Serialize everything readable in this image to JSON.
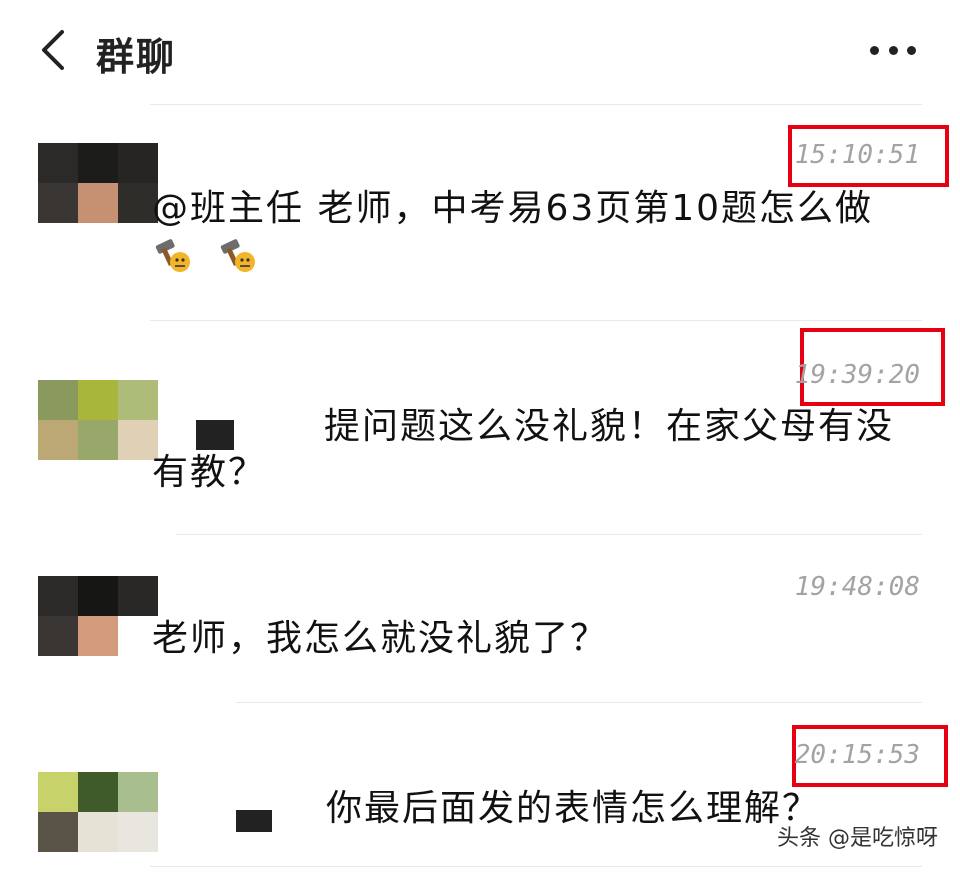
{
  "header": {
    "title": "群聊",
    "back_icon": "chevron-left-icon",
    "more_icon": "more-horizontal-icon"
  },
  "messages": [
    {
      "time": "15:10:51",
      "text": "@班主任 老师，中考易63页第10题怎么做",
      "emoji": [
        "hammer-emoji",
        "hammer-emoji"
      ],
      "highlighted": true,
      "avatar_colors": [
        "#2b2a28",
        "#1c1c1a",
        "#262523",
        "#3a3634",
        "#c69073",
        "#2f2d2a"
      ]
    },
    {
      "time": "19:39:20",
      "text": "提问题这么没礼貌！在家父母有没有教？",
      "highlighted": true,
      "avatar_colors": [
        "#8a9a5e",
        "#a9b63c",
        "#aebc7a",
        "#bba874",
        "#98a86a",
        "#e0d1b6"
      ]
    },
    {
      "time": "19:48:08",
      "text": "老师，我怎么就没礼貌了？",
      "highlighted": false,
      "avatar_colors": [
        "#2b2a28",
        "#161614",
        "#2a2826",
        "#3a3634",
        "#d39a7c",
        "#ffffff"
      ]
    },
    {
      "time": "20:15:53",
      "text": "你最后面发的表情怎么理解？",
      "highlighted": true,
      "avatar_colors": [
        "#c7d36a",
        "#3f5b2a",
        "#a9be8e",
        "#5a5448",
        "#e6e3d6",
        "#e8e6df"
      ]
    }
  ],
  "colors": {
    "highlight_border": "#e60012",
    "timestamp": "#a3a3a3",
    "divider": "#e9e9e9"
  },
  "watermark": "头条 @是吃惊呀"
}
